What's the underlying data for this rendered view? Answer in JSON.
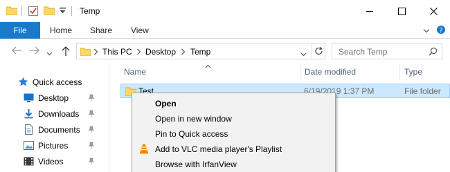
{
  "window": {
    "title": "Temp",
    "minimize_glyph": "—",
    "maximize_glyph": "☐",
    "close_glyph": "✕"
  },
  "ribbon": {
    "tabs": [
      "File",
      "Home",
      "Share",
      "View"
    ]
  },
  "address": {
    "crumbs": [
      "This PC",
      "Desktop",
      "Temp"
    ],
    "search_placeholder": "Search Temp"
  },
  "nav": {
    "items": [
      {
        "label": "Quick access",
        "icon": "star-icon"
      },
      {
        "label": "Desktop",
        "icon": "desktop-icon"
      },
      {
        "label": "Downloads",
        "icon": "download-icon"
      },
      {
        "label": "Documents",
        "icon": "documents-icon"
      },
      {
        "label": "Pictures",
        "icon": "pictures-icon"
      },
      {
        "label": "Videos",
        "icon": "videos-icon"
      }
    ]
  },
  "columns": {
    "name": "Name",
    "date": "Date modified",
    "type": "Type"
  },
  "files": [
    {
      "name": "Test",
      "date": "6/19/2019 1:37 PM",
      "type": "File folder"
    }
  ],
  "context_menu": {
    "items": [
      {
        "label": "Open",
        "bold": true
      },
      {
        "label": "Open in new window"
      },
      {
        "label": "Pin to Quick access"
      },
      {
        "label": "Add to VLC media player's Playlist",
        "icon": "vlc-icon"
      },
      {
        "label": "Browse with IrfanView"
      }
    ]
  },
  "colors": {
    "accent": "#1979ca",
    "selection": "#cce8ff",
    "selection_border": "#99d1ff",
    "folder": "#ffd766"
  }
}
